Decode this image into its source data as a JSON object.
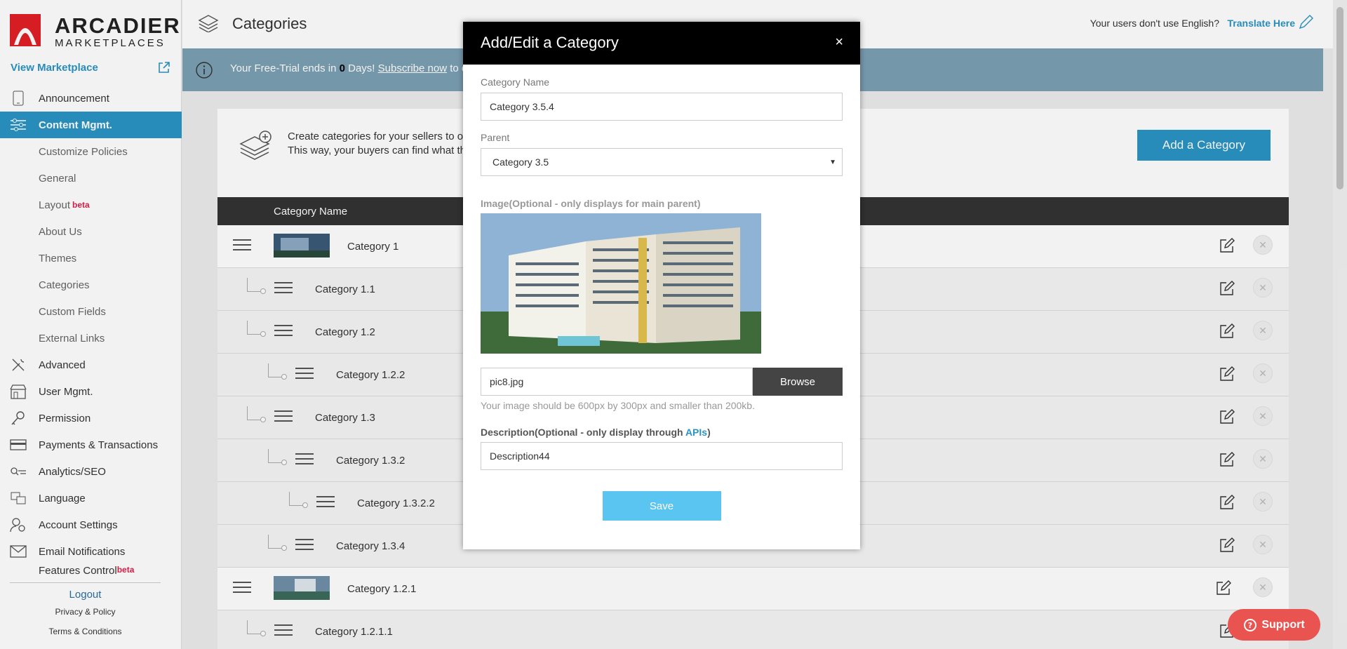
{
  "sidebar": {
    "logo_line1": "ARCADIER",
    "logo_line2": "MARKETPLACES",
    "view_marketplace": "View Marketplace",
    "nav": [
      {
        "label": "Announcement"
      },
      {
        "label": "Content Mgmt."
      },
      {
        "label": "Customize Policies"
      },
      {
        "label": "General"
      },
      {
        "label": "Layout",
        "badge": "beta"
      },
      {
        "label": "About Us"
      },
      {
        "label": "Themes"
      },
      {
        "label": "Categories"
      },
      {
        "label": "Custom Fields"
      },
      {
        "label": "External Links"
      },
      {
        "label": "Advanced"
      },
      {
        "label": "User Mgmt."
      },
      {
        "label": "Permission"
      },
      {
        "label": "Payments & Transactions"
      },
      {
        "label": "Analytics/SEO"
      },
      {
        "label": "Language"
      },
      {
        "label": "Account Settings"
      },
      {
        "label": "Email Notifications"
      },
      {
        "label": "Features Control",
        "badge": "beta"
      }
    ],
    "logout": "Logout",
    "privacy": "Privacy & Policy",
    "terms": "Terms & Conditions"
  },
  "header": {
    "title": "Categories",
    "question": "Your users don't use English?",
    "translate": "Translate Here"
  },
  "banner": {
    "pre": "Your Free-Trial ends in ",
    "days": "0",
    "mid": " Days! ",
    "link": "Subscribe now",
    "post": " to e"
  },
  "intro": {
    "line1": "Create categories for your sellers to or",
    "line2": "This way, your buyers can find what th"
  },
  "add_button": "Add a Category",
  "table_header": "Category Name",
  "rows": [
    {
      "name": "Category 1"
    },
    {
      "name": "Category 1.1"
    },
    {
      "name": "Category 1.2"
    },
    {
      "name": "Category 1.2.2"
    },
    {
      "name": "Category 1.3"
    },
    {
      "name": "Category 1.3.2"
    },
    {
      "name": "Category 1.3.2.2"
    },
    {
      "name": "Category 1.3.4"
    },
    {
      "name": "Category 1.2.1"
    },
    {
      "name": "Category 1.2.1.1"
    }
  ],
  "modal": {
    "title": "Add/Edit a Category",
    "close": "×",
    "name_label": "Category Name",
    "name_value": "Category 3.5.4",
    "parent_label": "Parent",
    "parent_value": "Category 3.5",
    "image_label": "Image(Optional - only displays for main parent)",
    "file_name": "pic8.jpg",
    "browse": "Browse",
    "hint": "Your image should be 600px by 300px and smaller than 200kb.",
    "desc_label_pre": "Description(Optional - only display through ",
    "desc_label_link": "APIs",
    "desc_label_post": ")",
    "desc_value": "Description44",
    "save": "Save"
  },
  "support": "Support"
}
